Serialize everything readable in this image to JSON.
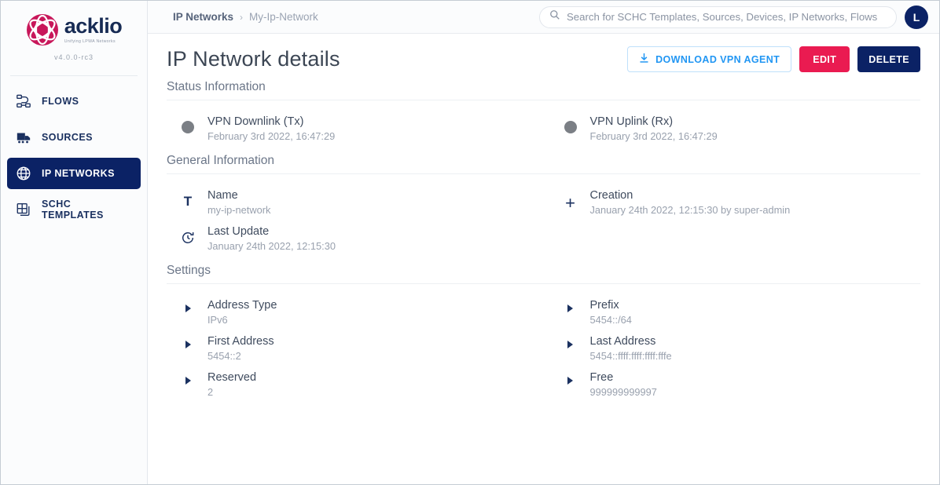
{
  "sidebar": {
    "brand": {
      "name": "acklio",
      "tagline": "Unifying LPWA Networks",
      "version": "v4.0.0-rc3"
    },
    "items": [
      {
        "label": "FLOWS",
        "icon": "flows-icon",
        "active": false
      },
      {
        "label": "SOURCES",
        "icon": "sources-icon",
        "active": false
      },
      {
        "label": "IP NETWORKS",
        "icon": "globe-icon",
        "active": true
      },
      {
        "label": "SCHC TEMPLATES",
        "icon": "templates-icon",
        "active": false
      }
    ]
  },
  "topbar": {
    "breadcrumb": {
      "root": "IP Networks",
      "separator": "›",
      "current": "My-Ip-Network"
    },
    "search": {
      "placeholder": "Search for SCHC Templates, Sources, Devices, IP Networks, Flows",
      "value": ""
    },
    "avatar": {
      "initial": "L"
    }
  },
  "page": {
    "title": "IP Network details",
    "buttons": {
      "download": "DOWNLOAD VPN AGENT",
      "edit": "EDIT",
      "delete": "DELETE"
    }
  },
  "sections": [
    {
      "title": "Status Information",
      "left": [
        {
          "icon": "status-dot-icon",
          "label": "VPN Downlink (Tx)",
          "value": "February 3rd 2022, 16:47:29"
        }
      ],
      "right": [
        {
          "icon": "status-dot-icon",
          "label": "VPN Uplink (Rx)",
          "value": "February 3rd 2022, 16:47:29"
        }
      ]
    },
    {
      "title": "General Information",
      "left": [
        {
          "icon": "text-icon",
          "label": "Name",
          "value": "my-ip-network"
        },
        {
          "icon": "history-icon",
          "label": "Last Update",
          "value": "January 24th 2022, 12:15:30"
        }
      ],
      "right": [
        {
          "icon": "plus-icon",
          "label": "Creation",
          "value": "January 24th 2022, 12:15:30 by super-admin"
        }
      ]
    },
    {
      "title": "Settings",
      "left": [
        {
          "icon": "triangle-icon",
          "label": "Address Type",
          "value": "IPv6"
        },
        {
          "icon": "triangle-icon",
          "label": "First Address",
          "value": "5454::2"
        },
        {
          "icon": "triangle-icon",
          "label": "Reserved",
          "value": "2"
        }
      ],
      "right": [
        {
          "icon": "triangle-icon",
          "label": "Prefix",
          "value": "5454::/64"
        },
        {
          "icon": "triangle-icon",
          "label": "Last Address",
          "value": "5454::ffff:ffff:ffff:fffe"
        },
        {
          "icon": "triangle-icon",
          "label": "Free",
          "value": "999999999997"
        }
      ]
    }
  ],
  "colors": {
    "navy": "#0b2265",
    "crimson": "#ea1b51",
    "blue": "#2196f3",
    "status_gray": "#7b7f85"
  }
}
